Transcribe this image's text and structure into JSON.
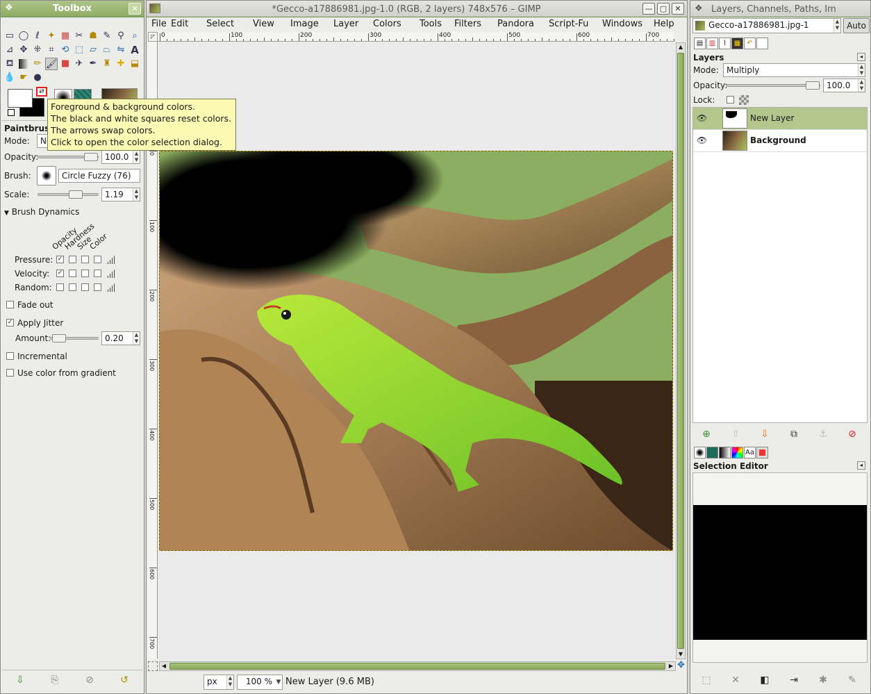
{
  "toolbox": {
    "title": "Toolbox",
    "tooltip": [
      "Foreground & background colors.",
      "The black and white squares reset colors.",
      "The arrows swap colors.",
      "Click to open the color selection dialog."
    ],
    "tool_options_title": "Paintbrush",
    "mode_label": "Mode:",
    "mode_value": "No",
    "opacity_label": "Opacity:",
    "opacity_value": "100.0",
    "opacity_fraction": 1.0,
    "brush_label": "Brush:",
    "brush_value": "Circle Fuzzy (76)",
    "scale_label": "Scale:",
    "scale_value": "1.19",
    "brush_dynamics_label": "Brush Dynamics",
    "dynamics_columns": [
      "Opacity",
      "Hardness",
      "Size",
      "Color"
    ],
    "dynamics_rows": [
      {
        "label": "Pressure:",
        "checked": [
          true,
          false,
          false,
          false
        ]
      },
      {
        "label": "Velocity:",
        "checked": [
          true,
          false,
          false,
          false
        ]
      },
      {
        "label": "Random:",
        "checked": [
          false,
          false,
          false,
          false
        ]
      }
    ],
    "fade_out_label": "Fade out",
    "fade_out_checked": false,
    "apply_jitter_label": "Apply Jitter",
    "apply_jitter_checked": true,
    "amount_label": "Amount:",
    "amount_value": "0.20",
    "incremental_label": "Incremental",
    "incremental_checked": false,
    "use_gradient_label": "Use color from gradient",
    "use_gradient_checked": false
  },
  "image_window": {
    "title": "*Gecco-a17886981.jpg-1.0 (RGB, 2 layers) 748x576 – GIMP",
    "menu": [
      "File",
      "Edit",
      "Select",
      "View",
      "Image",
      "Layer",
      "Colors",
      "Tools",
      "Filters",
      "Pandora",
      "Script-Fu",
      "Windows",
      "Help"
    ],
    "ruler_h_labels": [
      "0",
      "100",
      "200",
      "300",
      "400",
      "500",
      "600",
      "700"
    ],
    "ruler_v_labels": [
      "0",
      "100",
      "200",
      "300",
      "400",
      "500",
      "600",
      "700"
    ],
    "unit": "px",
    "zoom": "100 %",
    "status": "New Layer (9.6 MB)"
  },
  "layers_dock": {
    "title": "Layers, Channels, Paths, Im",
    "image_select": "Gecco-a17886981.jpg-1",
    "auto_button": "Auto",
    "section_title": "Layers",
    "mode_label": "Mode:",
    "mode_value": "Multiply",
    "opacity_label": "Opacity:",
    "opacity_value": "100.0",
    "opacity_fraction": 1.0,
    "lock_label": "Lock:",
    "layers": [
      {
        "name": "New Layer",
        "visible": true,
        "selected": true
      },
      {
        "name": "Background",
        "visible": true,
        "selected": false
      }
    ],
    "selection_editor_title": "Selection Editor"
  },
  "colors": {
    "titlebar": "#8eac62",
    "layer_selected": "#b3c68c",
    "tooltip_bg": "#fafab4",
    "scroll_accent": "#9ab86e"
  }
}
